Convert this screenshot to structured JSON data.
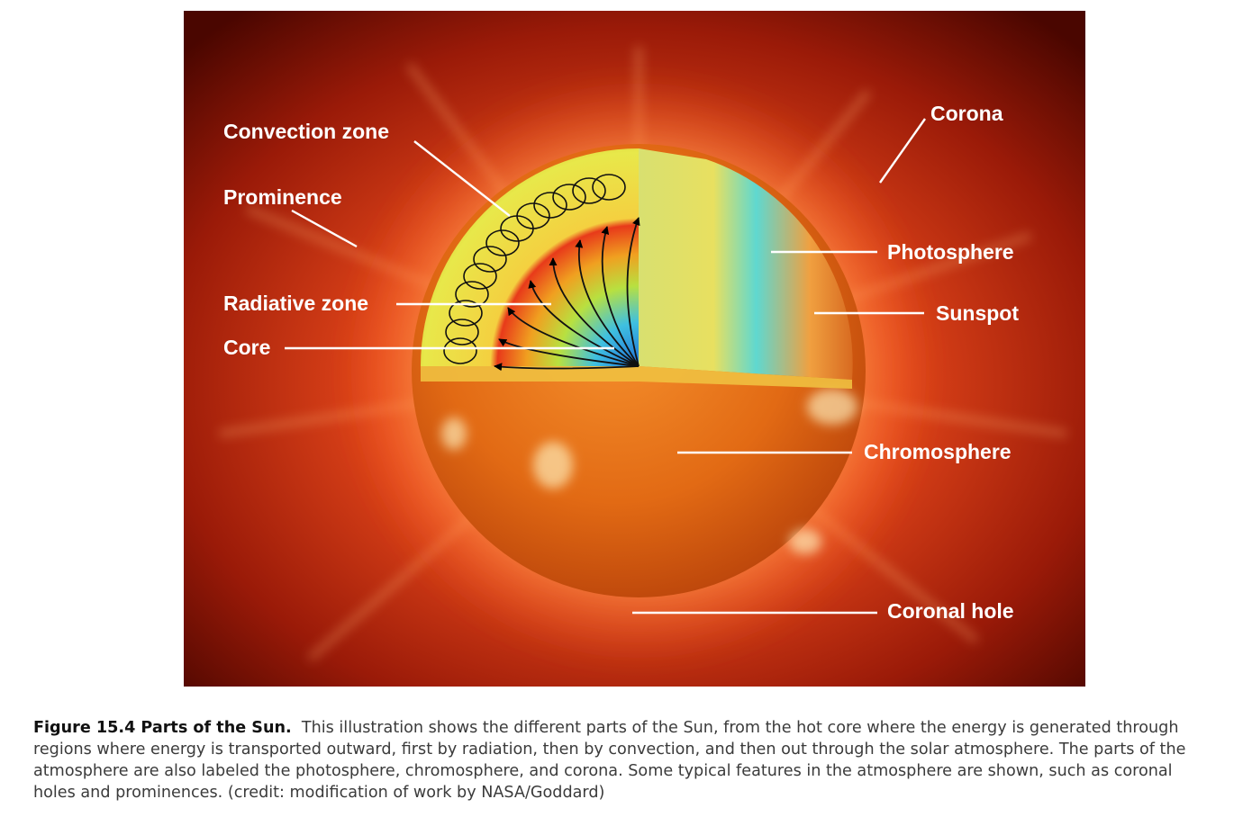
{
  "labels": {
    "convection_zone": "Convection zone",
    "prominence": "Prominence",
    "radiative_zone": "Radiative zone",
    "core": "Core",
    "corona": "Corona",
    "photosphere": "Photosphere",
    "sunspot": "Sunspot",
    "chromosphere": "Chromosphere",
    "coronal_hole": "Coronal hole"
  },
  "caption": {
    "title": "Figure 15.4 Parts of the Sun.",
    "text": "This illustration shows the different parts of the Sun, from the hot core where the energy is generated through regions where energy is transported outward, first by radiation, then by convection, and then out through the solar atmosphere. The parts of the atmosphere are also labeled the photosphere, chromosphere, and corona. Some typical features in the atmosphere are shown, such as coronal holes and prominences. (credit: modification of work by NASA/Goddard)"
  },
  "colors": {
    "background": "#6e0c00",
    "sun_surface": "#e86a10",
    "core": "#3aa0e0",
    "radiative_zone": "#e83a1a",
    "convection_zone": "#f0e040",
    "photosphere_band": "#5fd8d0",
    "label_text": "#ffffff"
  }
}
